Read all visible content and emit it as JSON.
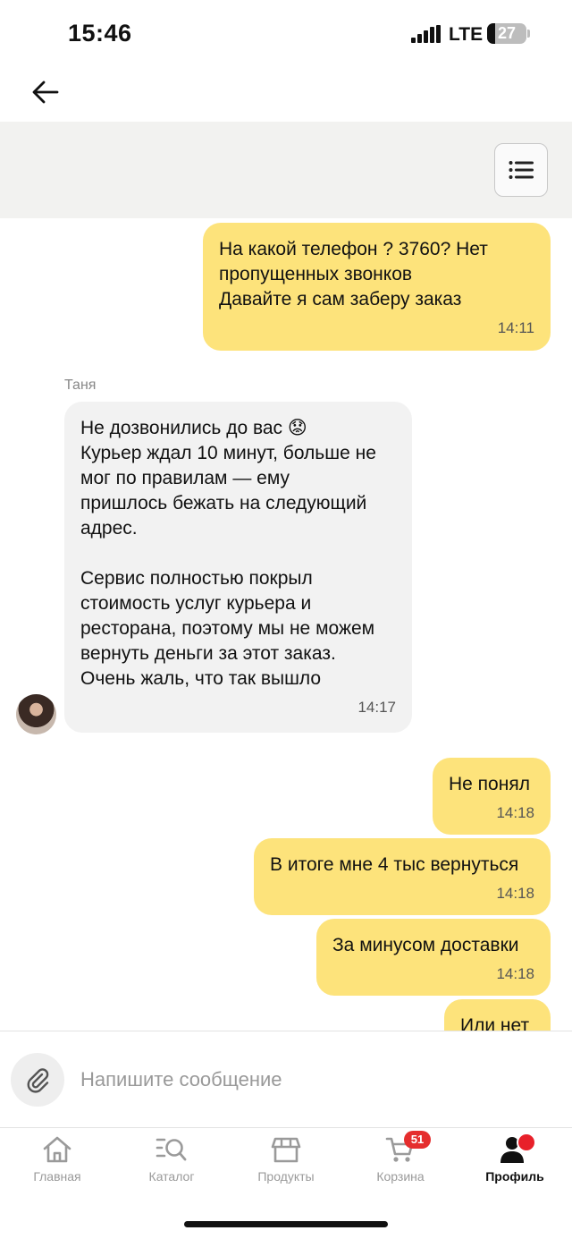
{
  "status_bar": {
    "time": "15:46",
    "network": "LTE",
    "battery": "27"
  },
  "header": {
    "back_icon": "arrow-left-icon",
    "menu_icon": "list-menu-icon"
  },
  "chat": {
    "sender_name": "Таня",
    "messages": [
      {
        "direction": "out",
        "text": "На какой телефон ? 3760? Нет\nпропущенных звонков\nДавайте я сам заберу заказ",
        "time": "14:11"
      },
      {
        "direction": "in",
        "sender": "Таня",
        "text": "Не дозвонились до вас 😟\nКурьер ждал 10 минут, больше не\nмог по правилам — ему\nпришлось бежать на следующий\nадрес.\n\nСервис полностью покрыл\nстоимость услуг курьера и\nресторана, поэтому мы не можем\nвернуть деньги за этот заказ.\nОчень жаль, что так вышло",
        "time": "14:17"
      },
      {
        "direction": "out",
        "text": "Не понял",
        "time": "14:18"
      },
      {
        "direction": "out",
        "text": "В итоге мне 4 тыс вернуться",
        "time": "14:18"
      },
      {
        "direction": "out",
        "text": "За минусом доставки",
        "time": "14:18"
      },
      {
        "direction": "out",
        "text": "Или нет",
        "time": ""
      }
    ]
  },
  "input": {
    "placeholder": "Напишите сообщение",
    "value": "",
    "attach_icon": "paperclip-icon"
  },
  "tab_bar": {
    "tabs": [
      {
        "label": "Главная",
        "icon": "home-icon",
        "active": false
      },
      {
        "label": "Каталог",
        "icon": "catalog-search-icon",
        "active": false
      },
      {
        "label": "Продукты",
        "icon": "store-icon",
        "active": false
      },
      {
        "label": "Корзина",
        "icon": "cart-icon",
        "active": false,
        "badge": "51"
      },
      {
        "label": "Профиль",
        "icon": "profile-icon",
        "active": true
      }
    ]
  },
  "colors": {
    "outgoing_bubble": "#fde37b",
    "incoming_bubble": "#f2f2f2",
    "badge": "#e52d2d"
  }
}
